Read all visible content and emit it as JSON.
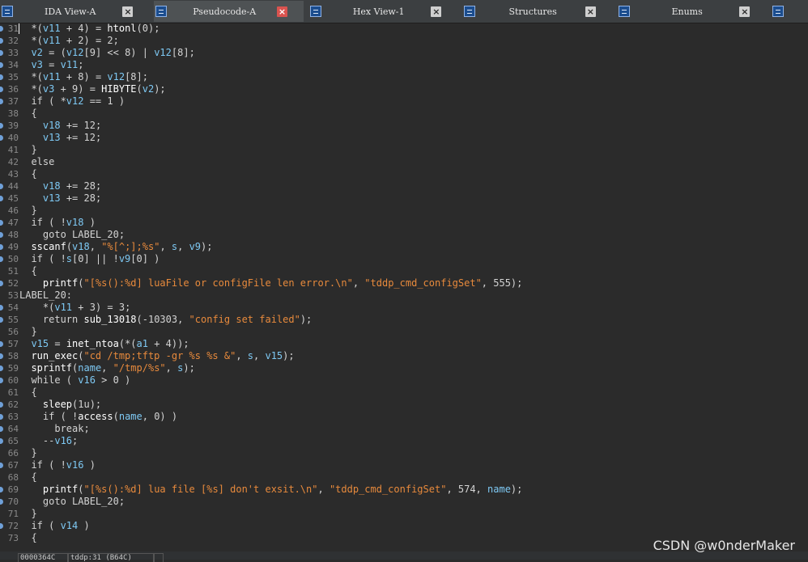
{
  "tabs": [
    {
      "label": "IDA View-A",
      "active": false,
      "icon": "ida-view-icon"
    },
    {
      "label": "Pseudocode-A",
      "active": true,
      "icon": "pseudocode-icon"
    },
    {
      "label": "Hex View-1",
      "active": false,
      "icon": "hex-view-icon"
    },
    {
      "label": "Structures",
      "active": false,
      "icon": "structures-icon"
    },
    {
      "label": "Enums",
      "active": false,
      "icon": "enums-icon"
    }
  ],
  "code_lines": [
    {
      "n": "31",
      "bp": true,
      "t": [
        [
          "p",
          "  *("
        ],
        [
          "v",
          "v11"
        ],
        [
          "p",
          " + 4) = "
        ],
        [
          "f",
          "htonl"
        ],
        [
          "p",
          "(0);"
        ]
      ]
    },
    {
      "n": "32",
      "bp": true,
      "t": [
        [
          "p",
          "  *("
        ],
        [
          "v",
          "v11"
        ],
        [
          "p",
          " + 2) = 2;"
        ]
      ]
    },
    {
      "n": "33",
      "bp": true,
      "t": [
        [
          "p",
          "  "
        ],
        [
          "v",
          "v2"
        ],
        [
          "p",
          " = ("
        ],
        [
          "v",
          "v12"
        ],
        [
          "p",
          "[9] << 8) | "
        ],
        [
          "v",
          "v12"
        ],
        [
          "p",
          "[8];"
        ]
      ]
    },
    {
      "n": "34",
      "bp": true,
      "t": [
        [
          "p",
          "  "
        ],
        [
          "v",
          "v3"
        ],
        [
          "p",
          " = "
        ],
        [
          "v",
          "v11"
        ],
        [
          "p",
          ";"
        ]
      ]
    },
    {
      "n": "35",
      "bp": true,
      "t": [
        [
          "p",
          "  *("
        ],
        [
          "v",
          "v11"
        ],
        [
          "p",
          " + 8) = "
        ],
        [
          "v",
          "v12"
        ],
        [
          "p",
          "[8];"
        ]
      ]
    },
    {
      "n": "36",
      "bp": true,
      "t": [
        [
          "p",
          "  *("
        ],
        [
          "v",
          "v3"
        ],
        [
          "p",
          " + 9) = "
        ],
        [
          "f",
          "HIBYTE"
        ],
        [
          "p",
          "("
        ],
        [
          "v",
          "v2"
        ],
        [
          "p",
          ");"
        ]
      ]
    },
    {
      "n": "37",
      "bp": true,
      "t": [
        [
          "p",
          "  if ( *"
        ],
        [
          "v",
          "v12"
        ],
        [
          "p",
          " == 1 )"
        ]
      ]
    },
    {
      "n": "38",
      "bp": false,
      "t": [
        [
          "p",
          "  {"
        ]
      ]
    },
    {
      "n": "39",
      "bp": true,
      "t": [
        [
          "p",
          "    "
        ],
        [
          "v",
          "v18"
        ],
        [
          "p",
          " += 12;"
        ]
      ]
    },
    {
      "n": "40",
      "bp": true,
      "t": [
        [
          "p",
          "    "
        ],
        [
          "v",
          "v13"
        ],
        [
          "p",
          " += 12;"
        ]
      ]
    },
    {
      "n": "41",
      "bp": false,
      "t": [
        [
          "p",
          "  }"
        ]
      ]
    },
    {
      "n": "42",
      "bp": false,
      "t": [
        [
          "p",
          "  else"
        ]
      ]
    },
    {
      "n": "43",
      "bp": false,
      "t": [
        [
          "p",
          "  {"
        ]
      ]
    },
    {
      "n": "44",
      "bp": true,
      "t": [
        [
          "p",
          "    "
        ],
        [
          "v",
          "v18"
        ],
        [
          "p",
          " += 28;"
        ]
      ]
    },
    {
      "n": "45",
      "bp": true,
      "t": [
        [
          "p",
          "    "
        ],
        [
          "v",
          "v13"
        ],
        [
          "p",
          " += 28;"
        ]
      ]
    },
    {
      "n": "46",
      "bp": false,
      "t": [
        [
          "p",
          "  }"
        ]
      ]
    },
    {
      "n": "47",
      "bp": true,
      "t": [
        [
          "p",
          "  if ( !"
        ],
        [
          "v",
          "v18"
        ],
        [
          "p",
          " )"
        ]
      ]
    },
    {
      "n": "48",
      "bp": true,
      "t": [
        [
          "p",
          "    goto LABEL_20;"
        ]
      ]
    },
    {
      "n": "49",
      "bp": true,
      "t": [
        [
          "p",
          "  "
        ],
        [
          "f",
          "sscanf"
        ],
        [
          "p",
          "("
        ],
        [
          "v",
          "v18"
        ],
        [
          "p",
          ", "
        ],
        [
          "s",
          "\"%[^;];%s\""
        ],
        [
          "p",
          ", "
        ],
        [
          "v",
          "s"
        ],
        [
          "p",
          ", "
        ],
        [
          "v",
          "v9"
        ],
        [
          "p",
          ");"
        ]
      ]
    },
    {
      "n": "50",
      "bp": true,
      "t": [
        [
          "p",
          "  if ( !"
        ],
        [
          "v",
          "s"
        ],
        [
          "p",
          "[0] || !"
        ],
        [
          "v",
          "v9"
        ],
        [
          "p",
          "[0] )"
        ]
      ]
    },
    {
      "n": "51",
      "bp": false,
      "t": [
        [
          "p",
          "  {"
        ]
      ]
    },
    {
      "n": "52",
      "bp": true,
      "t": [
        [
          "p",
          "    "
        ],
        [
          "f",
          "printf"
        ],
        [
          "p",
          "("
        ],
        [
          "s",
          "\"[%s():%d] luaFile or configFile len error.\\n\""
        ],
        [
          "p",
          ", "
        ],
        [
          "s",
          "\"tddp_cmd_configSet\""
        ],
        [
          "p",
          ", 555);"
        ]
      ]
    },
    {
      "n": "53",
      "bp": false,
      "t": [
        [
          "p",
          "LABEL_20:"
        ]
      ]
    },
    {
      "n": "54",
      "bp": true,
      "t": [
        [
          "p",
          "    *("
        ],
        [
          "v",
          "v11"
        ],
        [
          "p",
          " + 3) = 3;"
        ]
      ]
    },
    {
      "n": "55",
      "bp": true,
      "t": [
        [
          "p",
          "    return "
        ],
        [
          "f",
          "sub_13018"
        ],
        [
          "p",
          "(-10303, "
        ],
        [
          "s",
          "\"config set failed\""
        ],
        [
          "p",
          ");"
        ]
      ]
    },
    {
      "n": "56",
      "bp": false,
      "t": [
        [
          "p",
          "  }"
        ]
      ]
    },
    {
      "n": "57",
      "bp": true,
      "t": [
        [
          "p",
          "  "
        ],
        [
          "v",
          "v15"
        ],
        [
          "p",
          " = "
        ],
        [
          "f",
          "inet_ntoa"
        ],
        [
          "p",
          "(*("
        ],
        [
          "v",
          "a1"
        ],
        [
          "p",
          " + 4));"
        ]
      ]
    },
    {
      "n": "58",
      "bp": true,
      "t": [
        [
          "p",
          "  "
        ],
        [
          "f",
          "run_exec"
        ],
        [
          "p",
          "("
        ],
        [
          "s",
          "\"cd /tmp;tftp -gr %s %s &\""
        ],
        [
          "p",
          ", "
        ],
        [
          "v",
          "s"
        ],
        [
          "p",
          ", "
        ],
        [
          "v",
          "v15"
        ],
        [
          "p",
          ");"
        ]
      ]
    },
    {
      "n": "59",
      "bp": true,
      "t": [
        [
          "p",
          "  "
        ],
        [
          "f",
          "sprintf"
        ],
        [
          "p",
          "("
        ],
        [
          "v",
          "name"
        ],
        [
          "p",
          ", "
        ],
        [
          "s",
          "\"/tmp/%s\""
        ],
        [
          "p",
          ", "
        ],
        [
          "v",
          "s"
        ],
        [
          "p",
          ");"
        ]
      ]
    },
    {
      "n": "60",
      "bp": true,
      "t": [
        [
          "p",
          "  while ( "
        ],
        [
          "v",
          "v16"
        ],
        [
          "p",
          " > 0 )"
        ]
      ]
    },
    {
      "n": "61",
      "bp": false,
      "t": [
        [
          "p",
          "  {"
        ]
      ]
    },
    {
      "n": "62",
      "bp": true,
      "t": [
        [
          "p",
          "    "
        ],
        [
          "f",
          "sleep"
        ],
        [
          "p",
          "(1u);"
        ]
      ]
    },
    {
      "n": "63",
      "bp": true,
      "t": [
        [
          "p",
          "    if ( !"
        ],
        [
          "f",
          "access"
        ],
        [
          "p",
          "("
        ],
        [
          "v",
          "name"
        ],
        [
          "p",
          ", 0) )"
        ]
      ]
    },
    {
      "n": "64",
      "bp": true,
      "t": [
        [
          "p",
          "      break;"
        ]
      ]
    },
    {
      "n": "65",
      "bp": true,
      "t": [
        [
          "p",
          "    --"
        ],
        [
          "v",
          "v16"
        ],
        [
          "p",
          ";"
        ]
      ]
    },
    {
      "n": "66",
      "bp": false,
      "t": [
        [
          "p",
          "  }"
        ]
      ]
    },
    {
      "n": "67",
      "bp": true,
      "t": [
        [
          "p",
          "  if ( !"
        ],
        [
          "v",
          "v16"
        ],
        [
          "p",
          " )"
        ]
      ]
    },
    {
      "n": "68",
      "bp": false,
      "t": [
        [
          "p",
          "  {"
        ]
      ]
    },
    {
      "n": "69",
      "bp": true,
      "t": [
        [
          "p",
          "    "
        ],
        [
          "f",
          "printf"
        ],
        [
          "p",
          "("
        ],
        [
          "s",
          "\"[%s():%d] lua file [%s] don't exsit.\\n\""
        ],
        [
          "p",
          ", "
        ],
        [
          "s",
          "\"tddp_cmd_configSet\""
        ],
        [
          "p",
          ", 574, "
        ],
        [
          "v",
          "name"
        ],
        [
          "p",
          ");"
        ]
      ]
    },
    {
      "n": "70",
      "bp": true,
      "t": [
        [
          "p",
          "    goto LABEL_20;"
        ]
      ]
    },
    {
      "n": "71",
      "bp": false,
      "t": [
        [
          "p",
          "  }"
        ]
      ]
    },
    {
      "n": "72",
      "bp": true,
      "t": [
        [
          "p",
          "  if ( "
        ],
        [
          "v",
          "v14"
        ],
        [
          "p",
          " )"
        ]
      ]
    },
    {
      "n": "73",
      "bp": false,
      "t": [
        [
          "p",
          "  {"
        ]
      ]
    }
  ],
  "status": {
    "address": "0000364C",
    "location": "tddp:31 (B64C)"
  },
  "watermark": "CSDN @w0nderMaker",
  "colors": {
    "background": "#2b2b2b",
    "variable": "#7ec9f4",
    "function": "#ffffff",
    "string": "#e88a3c",
    "line_number": "#8a8a8a"
  }
}
